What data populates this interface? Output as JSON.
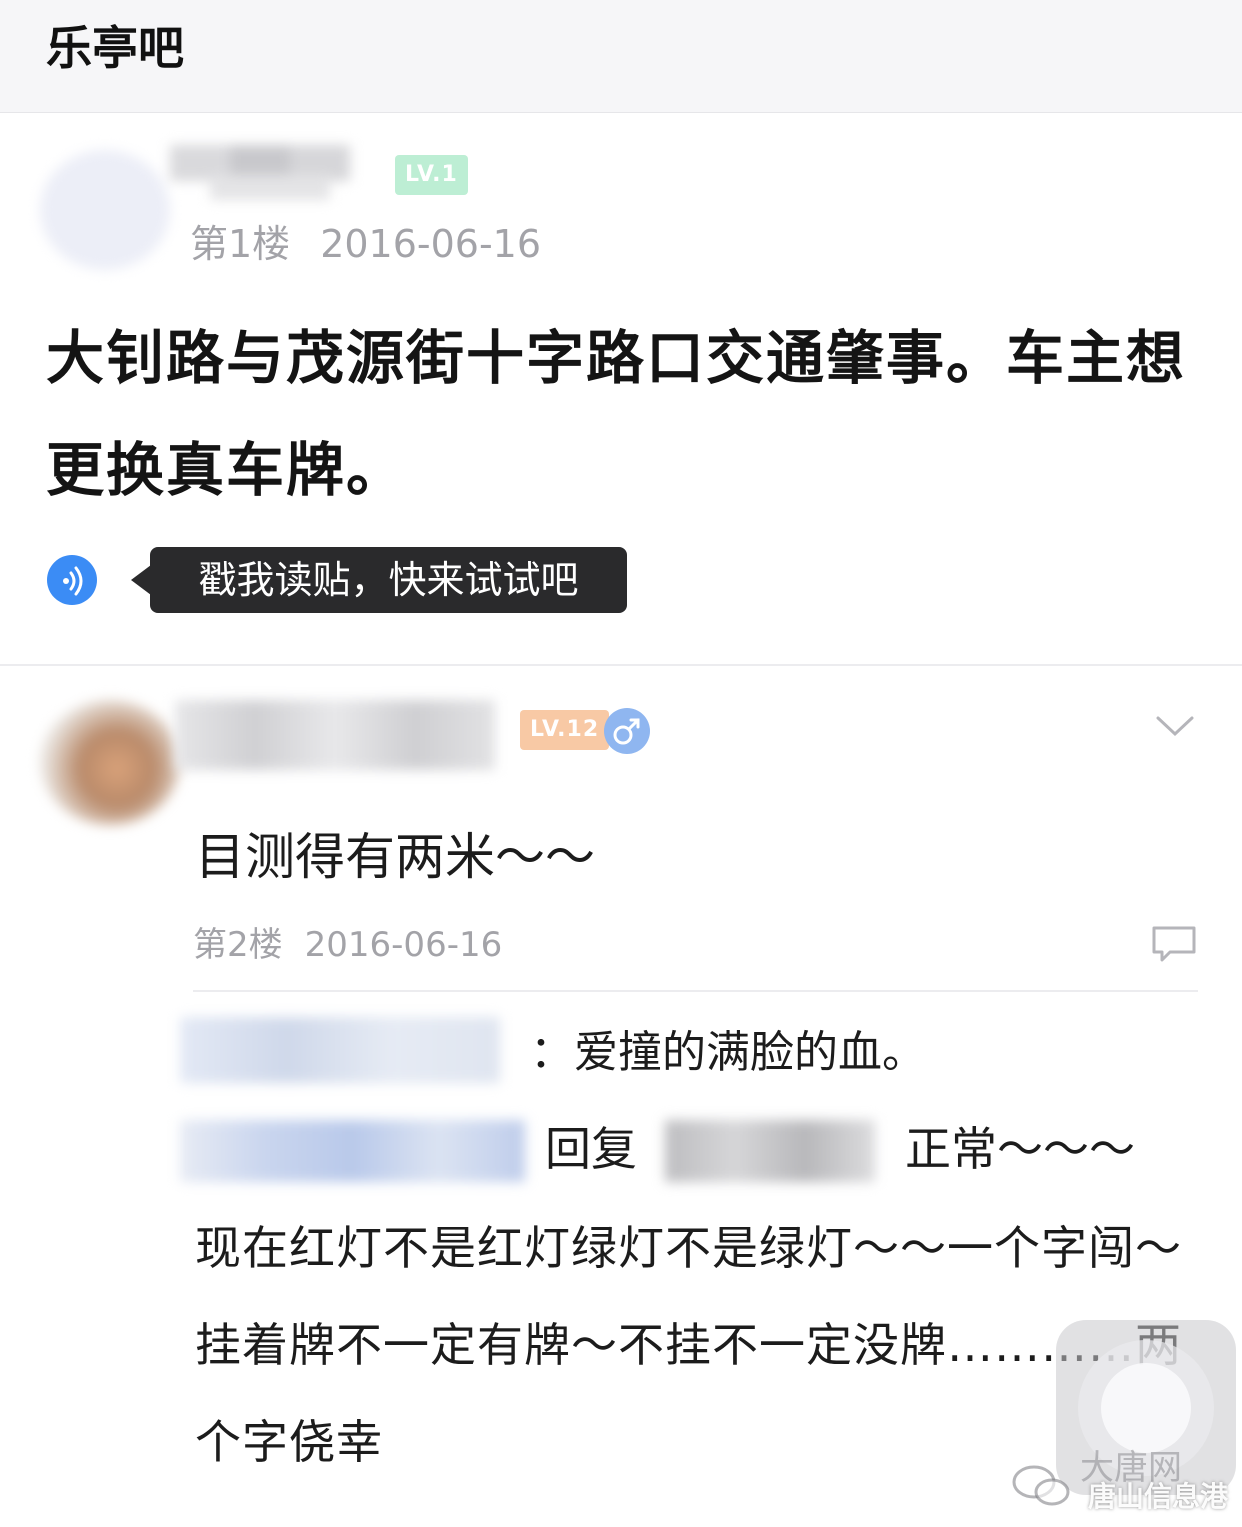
{
  "topbar": {
    "title": "乐亭吧"
  },
  "post": {
    "level": "LV.1",
    "floor": "第1楼",
    "date": "2016-06-16",
    "title": "大钊路与茂源街十字路口交通肇事。车主想更换真车牌。",
    "voice_tip": "戳我读贴，快来试试吧"
  },
  "reply": {
    "level": "LV.12",
    "text": "目测得有两米～～",
    "floor": "第2楼",
    "date": "2016-06-16",
    "sub_comment_1": "：爱撞的满脸的血。",
    "reply_word": "回复",
    "sub_comment_2_head": "正常～～～",
    "sub_comment_2_body": "现在红灯不是红灯绿灯不是绿灯～～一个字闯～挂着牌不一定有牌～不挂不一定没牌…………两个字侥幸"
  },
  "watermark": {
    "line1": "大唐网",
    "line2": "唐山信息港"
  },
  "colors": {
    "level_green": "#b7ecd0",
    "level_orange": "#f7c9a8",
    "voice_blue": "#3b8cf5",
    "gender_blue": "#8fb6f0"
  },
  "icons": [
    "voice-icon",
    "gender-male-icon",
    "chevron-down-icon",
    "comment-icon",
    "wechat-icon"
  ]
}
